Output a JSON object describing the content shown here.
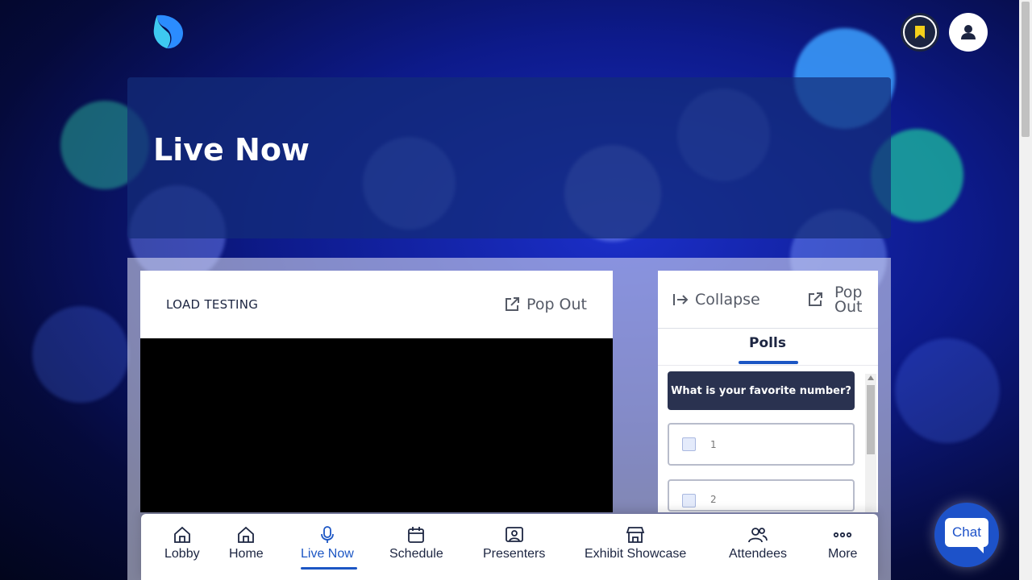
{
  "header": {
    "logo_icon": "brand-logo-icon",
    "bookmark_icon": "bookmark-icon",
    "profile_icon": "user-icon"
  },
  "hero": {
    "title": "Live Now"
  },
  "video": {
    "title": "LOAD TESTING",
    "popout_label": "Pop Out"
  },
  "side_panel": {
    "collapse_label": "Collapse",
    "popout_label": "Pop Out",
    "tabs": [
      {
        "label": "Polls",
        "active": true
      }
    ],
    "poll": {
      "question": "What is your favorite number?",
      "options": [
        "1",
        "2"
      ]
    }
  },
  "nav": {
    "items": [
      {
        "label": "Lobby",
        "icon": "house-icon"
      },
      {
        "label": "Home",
        "icon": "house-icon"
      },
      {
        "label": "Live Now",
        "icon": "microphone-icon",
        "active": true
      },
      {
        "label": "Schedule",
        "icon": "calendar-icon"
      },
      {
        "label": "Presenters",
        "icon": "presenter-icon"
      },
      {
        "label": "Exhibit Showcase",
        "icon": "storefront-icon"
      },
      {
        "label": "Attendees",
        "icon": "people-icon"
      },
      {
        "label": "More",
        "icon": "more-dots-icon"
      }
    ]
  },
  "chat": {
    "label": "Chat"
  },
  "colors": {
    "accent": "#1c56c4",
    "dark": "#1c2541",
    "chat": "#1d52c9",
    "bookmark": "#f5d11a"
  }
}
